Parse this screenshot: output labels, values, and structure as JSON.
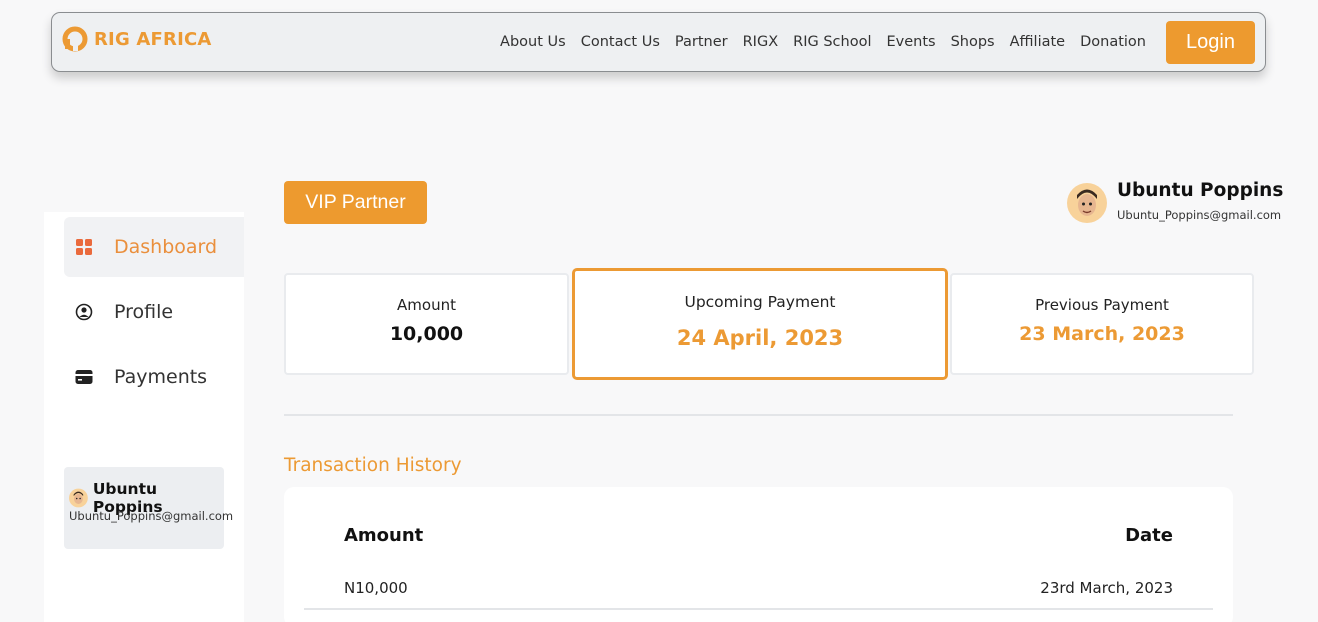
{
  "brand": {
    "name": "RIG AFRICA",
    "accent": "#ec9a34"
  },
  "nav": {
    "items": [
      "About Us",
      "Contact Us",
      "Partner",
      "RIGX",
      "RIG School",
      "Events",
      "Shops",
      "Affiliate",
      "Donation"
    ],
    "login_label": "Login"
  },
  "sidebar": {
    "items": [
      {
        "label": "Dashboard",
        "icon": "grid-icon",
        "active": true
      },
      {
        "label": "Profile",
        "icon": "user-circle-icon",
        "active": false
      },
      {
        "label": "Payments",
        "icon": "card-icon",
        "active": false
      }
    ],
    "user": {
      "name": "Ubuntu Poppins",
      "email": "Ubuntu_Poppins@gmail.com"
    }
  },
  "header": {
    "badge_label": "VIP Partner",
    "user": {
      "name": "Ubuntu Poppins",
      "email": "Ubuntu_Poppins@gmail.com"
    }
  },
  "stats": {
    "amount": {
      "label": "Amount",
      "value": "10,000"
    },
    "upcoming": {
      "label": "Upcoming Payment",
      "value": "24 April, 2023"
    },
    "previous": {
      "label": "Previous Payment",
      "value": "23 March, 2023"
    }
  },
  "transactions": {
    "title": "Transaction History",
    "columns": [
      "Amount",
      "Date"
    ],
    "rows": [
      {
        "amount": "N10,000",
        "date": "23rd March, 2023"
      }
    ]
  }
}
